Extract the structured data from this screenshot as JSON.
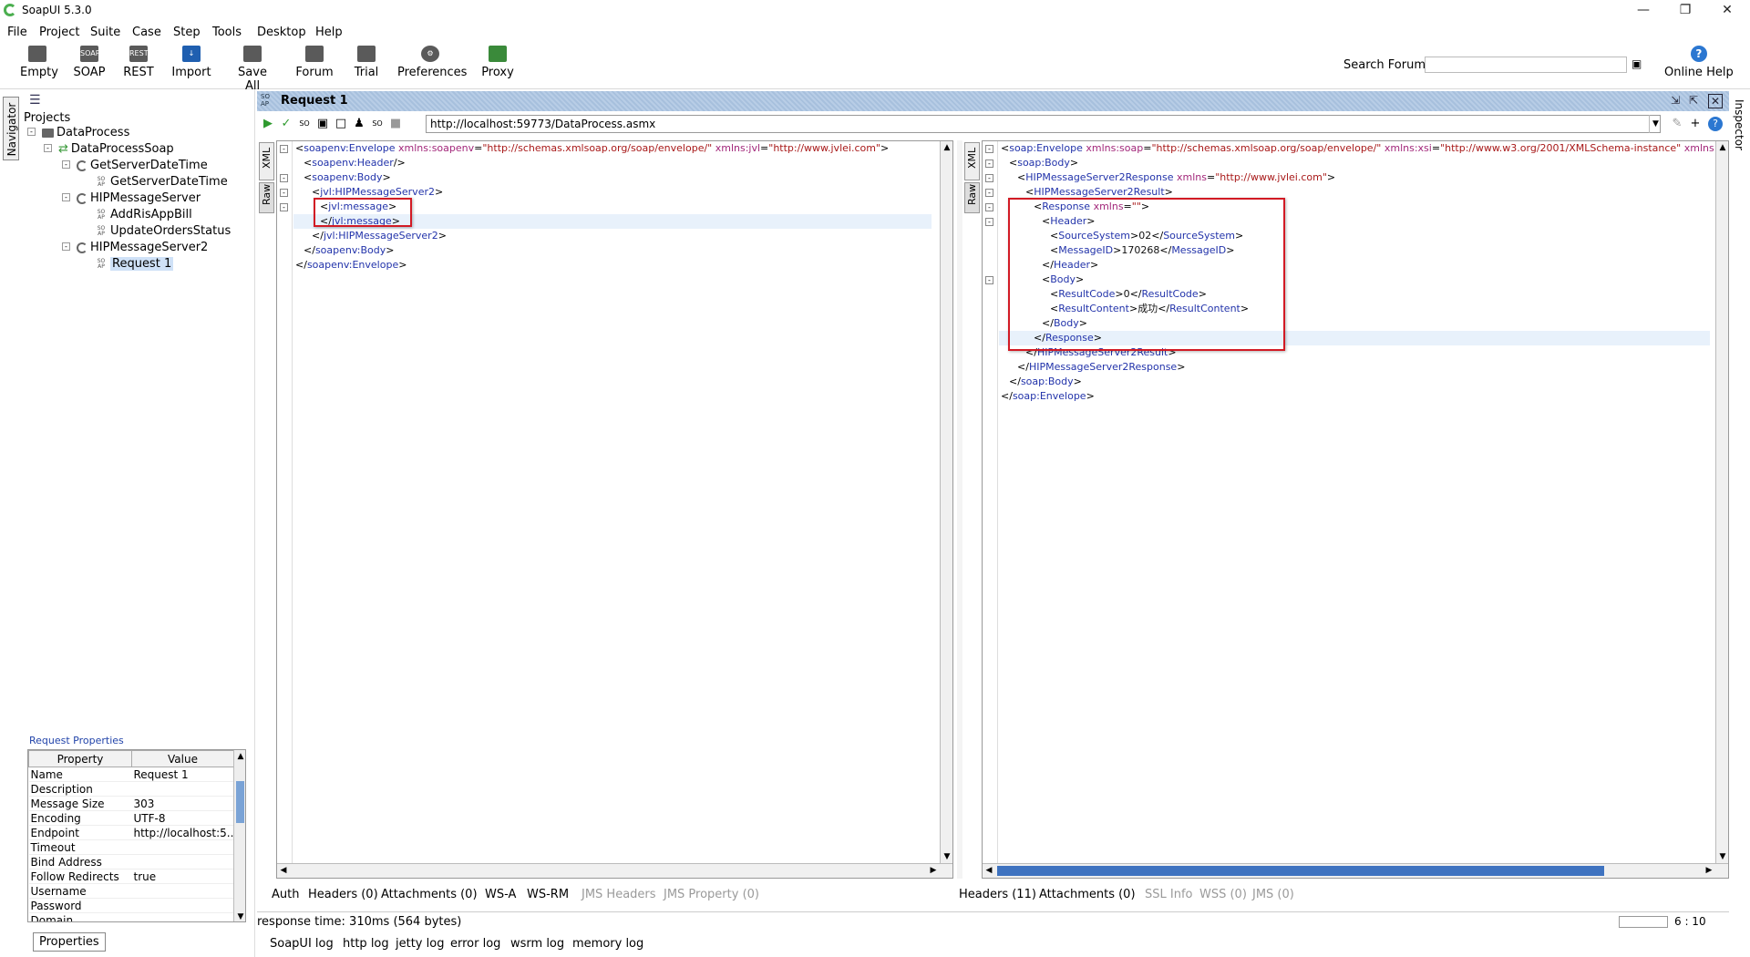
{
  "window": {
    "title": "SoapUI 5.3.0"
  },
  "menu": [
    "File",
    "Project",
    "Suite",
    "Case",
    "Step",
    "Tools",
    "Desktop",
    "Help"
  ],
  "toolbar": {
    "buttons": [
      "Empty",
      "SOAP",
      "REST",
      "Import",
      "Save All",
      "Forum",
      "Trial",
      "Preferences",
      "Proxy"
    ],
    "search_forum_label": "Search Forum",
    "online_help": "Online Help"
  },
  "navigator": {
    "tab": "Navigator",
    "projects_label": "Projects",
    "tree": {
      "project": "DataProcess",
      "interface": "DataProcessSoap",
      "op1": "GetServerDateTime",
      "op1_req": "GetServerDateTime",
      "op2": "HIPMessageServer",
      "op2_req1": "AddRisAppBill",
      "op2_req2": "UpdateOrdersStatus",
      "op3": "HIPMessageServer2",
      "op3_req": "Request 1"
    }
  },
  "properties": {
    "title": "Request Properties",
    "headers": [
      "Property",
      "Value"
    ],
    "rows": [
      [
        "Name",
        "Request 1"
      ],
      [
        "Description",
        ""
      ],
      [
        "Message Size",
        "303"
      ],
      [
        "Encoding",
        "UTF-8"
      ],
      [
        "Endpoint",
        "http://localhost:5..."
      ],
      [
        "Timeout",
        ""
      ],
      [
        "Bind Address",
        ""
      ],
      [
        "Follow Redirects",
        "true"
      ],
      [
        "Username",
        ""
      ],
      [
        "Password",
        ""
      ],
      [
        "Domain",
        ""
      ]
    ],
    "tab": "Properties"
  },
  "request": {
    "title": "Request 1",
    "endpoint": "http://localhost:59773/DataProcess.asmx",
    "xml_tab": "XML",
    "raw_tab": "Raw",
    "bottom_tabs": [
      "Auth",
      "Headers (0)",
      "Attachments (0)",
      "WS-A",
      "WS-RM",
      "JMS Headers",
      "JMS Property (0)"
    ]
  },
  "response": {
    "xml_tab": "XML",
    "raw_tab": "Raw",
    "bottom_tabs": [
      "Headers (11)",
      "Attachments (0)",
      "SSL Info",
      "WSS (0)",
      "JMS (0)"
    ]
  },
  "status": {
    "response_time": "response time: 310ms (564 bytes)",
    "cursor": "6 : 10"
  },
  "logs": [
    "SoapUI log",
    "http log",
    "jetty log",
    "error log",
    "wsrm log",
    "memory log"
  ],
  "inspector": {
    "tab": "Inspector"
  },
  "colors": {
    "tag": "#2233aa",
    "attr_name": "#a2277a",
    "attr_value": "#a81919",
    "highlight_box": "#d21a24",
    "header_bar": "#a7c0dd"
  }
}
